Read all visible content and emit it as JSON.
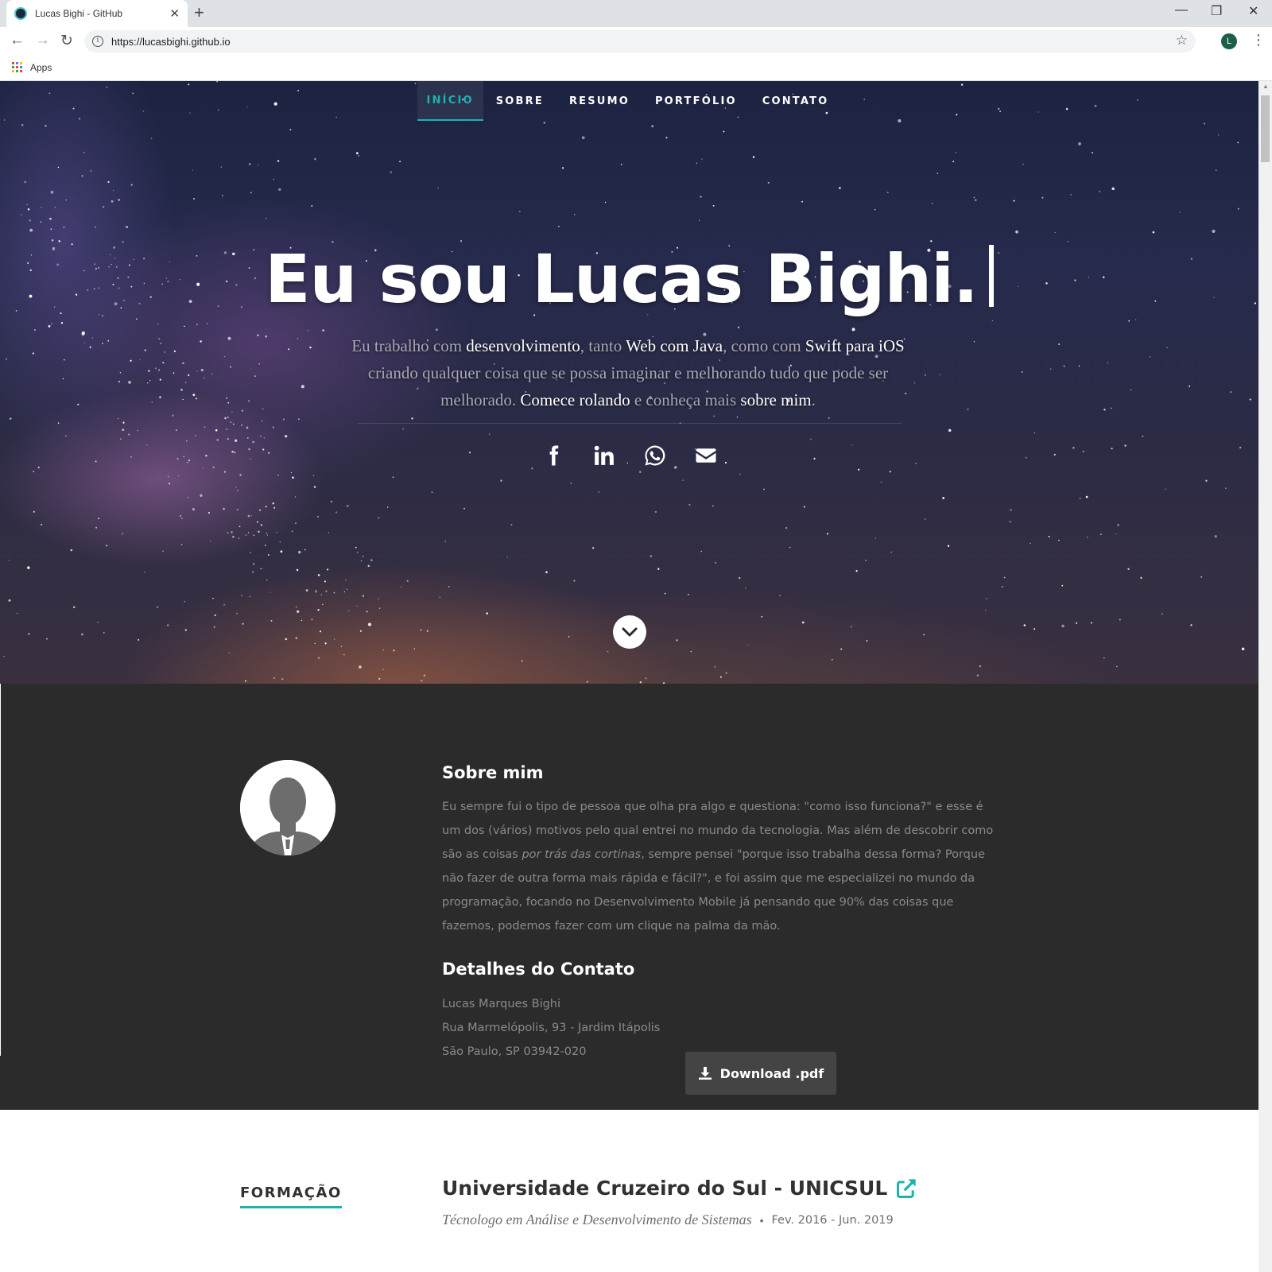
{
  "browser": {
    "tab_title": "Lucas Bighi - GitHub",
    "url": "https://lucasbighi.github.io",
    "profile_initial": "L",
    "bookmarks_apps_label": "Apps"
  },
  "nav": {
    "items": [
      {
        "label": "INÍCIO",
        "active": true
      },
      {
        "label": "SOBRE",
        "active": false
      },
      {
        "label": "RESUMO",
        "active": false
      },
      {
        "label": "PORTFÓLIO",
        "active": false
      },
      {
        "label": "CONTATO",
        "active": false
      }
    ]
  },
  "hero": {
    "title": "Eu sou Lucas Bighi.",
    "intro": {
      "t1": "Eu trabalho com ",
      "h1": "desenvolvimento",
      "t2": ", tanto ",
      "h2": "Web com Java",
      "t3": ", como com ",
      "h3": "Swift para iOS",
      "t4": " criando qualquer coisa que se possa imaginar e melhorando tudo que pode ser melhorado. ",
      "h4": "Comece rolando",
      "t5": " e conheça mais ",
      "h5": "sobre mim",
      "t6": "."
    },
    "social_icons": [
      "facebook-icon",
      "linkedin-icon",
      "whatsapp-icon",
      "envelope-icon"
    ]
  },
  "about": {
    "heading": "Sobre mim",
    "p_before": "Eu sempre fui o tipo de pessoa que olha pra algo e questiona: \"como isso funciona?\" e esse é um dos (vários) motivos pelo qual entrei no mundo da tecnologia. Mas além de descobrir como são as coisas ",
    "p_em": "por trás das cortinas",
    "p_after": ", sempre pensei \"porque isso trabalha dessa forma? Porque não fazer de outra forma mais rápida e fácil?\", e foi assim que me especializei no mundo da programação, focando no Desenvolvimento Mobile já pensando que 90% das coisas que fazemos, podemos fazer com um clique na palma da mão.",
    "contact_heading": "Detalhes do Contato",
    "contact_name": "Lucas Marques Bighi",
    "contact_street": "Rua Marmelópolis, 93 - Jardim Itápolis",
    "contact_city": "São Paulo, SP 03942-020",
    "download_label": "Download .pdf"
  },
  "resume": {
    "section_label": "FORMAÇÃO",
    "school": "Universidade Cruzeiro do Sul - UNICSUL",
    "course": "Técnologo em Análise e Desenvolvimento de Sistemas",
    "dates": "Fev. 2016 - Jun. 2019"
  },
  "colors": {
    "accent": "#1bb3b0",
    "about_bg": "#2b2b2b"
  }
}
